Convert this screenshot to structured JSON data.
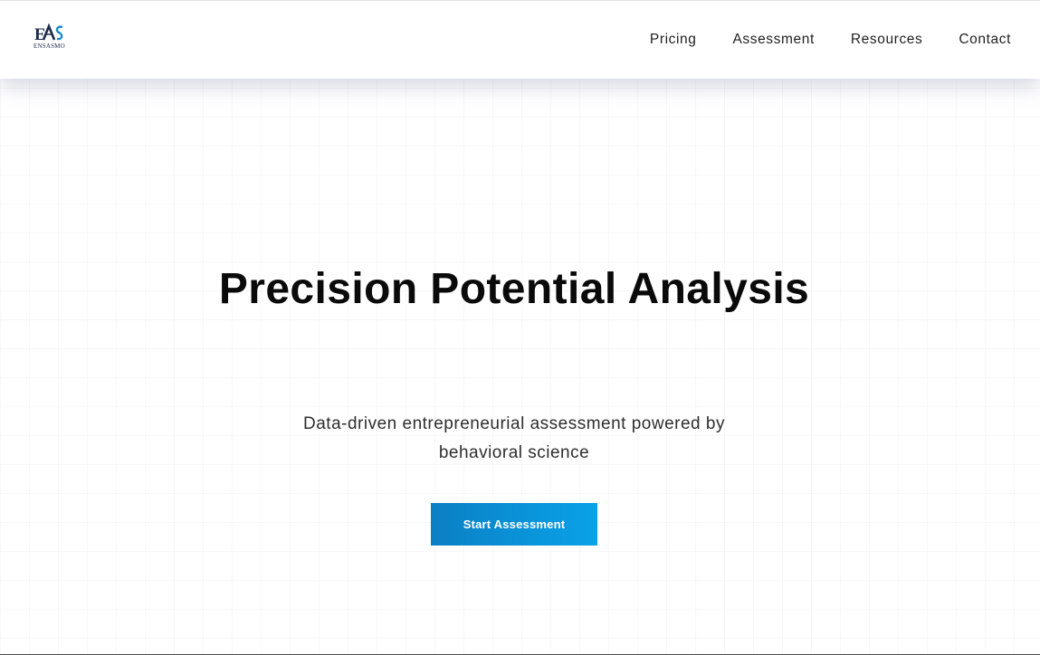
{
  "brand": {
    "logo_monogram": "EAS",
    "logo_wordmark": "ENSASMO",
    "logo_primary_color": "#1b2a4a",
    "logo_accent_color": "#1589c9"
  },
  "nav": {
    "items": [
      {
        "label": "Pricing"
      },
      {
        "label": "Assessment"
      },
      {
        "label": "Resources"
      },
      {
        "label": "Contact"
      }
    ]
  },
  "hero": {
    "title": "Precision Potential Analysis",
    "subtitle": "Data-driven entrepreneurial assessment powered by behavioral science",
    "cta_label": "Start Assessment",
    "cta_gradient_start": "#0b7fc4",
    "cta_gradient_end": "#0aa2e8"
  }
}
